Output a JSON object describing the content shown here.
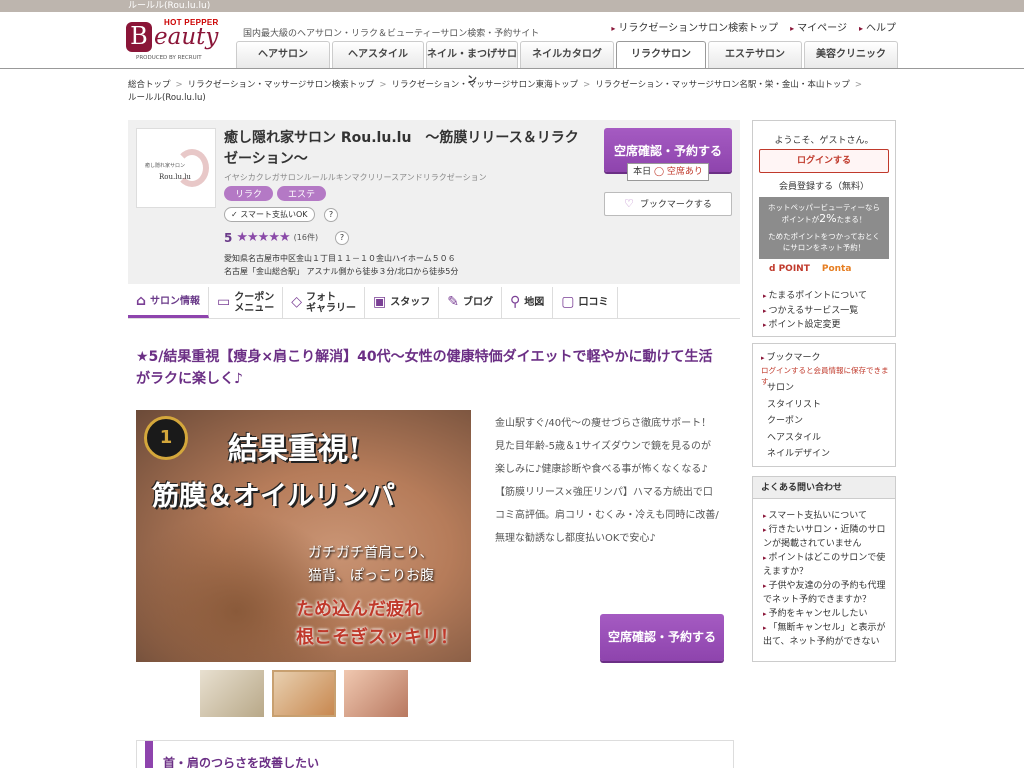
{
  "window": {
    "title": "ルールル(Rou.lu.lu)"
  },
  "header": {
    "logo": {
      "top": "HOT PEPPER",
      "b": "B",
      "rest": "eauty",
      "produced": "PRODUCED BY RECRUIT"
    },
    "tagline": "国内最大級のヘアサロン・リラク＆ビューティーサロン検索・予約サイト",
    "links": [
      "リラクゼーションサロン検索トップ",
      "マイページ",
      "ヘルプ"
    ],
    "nav": [
      "ヘアサロン",
      "ヘアスタイル",
      "ネイル・まつげサロン",
      "ネイルカタログ",
      "リラクサロン",
      "エステサロン",
      "美容クリニック"
    ]
  },
  "breadcrumb": [
    "総合トップ",
    "リラクゼーション・マッサージサロン検索トップ",
    "リラクゼーション・マッサージサロン東海トップ",
    "リラクゼーション・マッサージサロン名駅・栄・金山・本山トップ",
    "ルールル(Rou.lu.lu)"
  ],
  "salon": {
    "thumb_line1": "癒し隠れ家サロン",
    "thumb_line2": "Rou.lu.lu",
    "name": "癒し隠れ家サロン Rou.lu.lu　～筋膜リリース＆リラクゼーション～",
    "kana": "イヤシカクレガサロンルールルキンマクリリースアンドリラクゼーション",
    "tags": [
      "リラク",
      "エステ"
    ],
    "smart_pay": "✓ スマート支払いOK",
    "help_mark": "?",
    "rating": "5",
    "stars": "★★★★★",
    "review_count": "(16件)",
    "address": "愛知県名古屋市中区金山１丁目１１－１０金山ハイホーム５０６",
    "access": "名古屋「金山総合駅」 アスナル側から徒歩３分/北口から徒歩5分",
    "reserve_label": "空席確認・予約する",
    "avail_prefix": "本日",
    "avail_status": "◯ 空席あり",
    "bookmark_icon": "♡",
    "bookmark_label": "ブックマークする"
  },
  "tabs": [
    {
      "icon": "⌂",
      "label": "サロン情報"
    },
    {
      "icon": "▭",
      "label": "クーポン\nメニュー"
    },
    {
      "icon": "◇",
      "label": "フォト\nギャラリー"
    },
    {
      "icon": "▣",
      "label": "スタッフ"
    },
    {
      "icon": "✎",
      "label": "ブログ"
    },
    {
      "icon": "⚲",
      "label": "地図"
    },
    {
      "icon": "▢",
      "label": "口コミ"
    }
  ],
  "main": {
    "catch": "★5/結果重視【痩身×肩こり解消】40代～女性の健康特価ダイエットで軽やかに動けて生活がラクに楽しく♪",
    "hero": {
      "medal": "1",
      "line1": "結果重視!",
      "line2": "筋膜＆オイルリンパ",
      "line3a": "ガチガチ首肩こり、",
      "line3b": "猫背、ぽっこりお腹",
      "line4a": "ため込んだ疲れ",
      "line4b": "根こそぎスッキリ！"
    },
    "description": "金山駅すぐ/40代～の痩せづらさ徹底サポート！見た目年齢-5歳＆1サイズダウンで鏡を見るのが楽しみに♪健康診断や食べる事が怖くなくなる♪【筋膜リリース×強圧リンパ】ハマる方続出で口コミ高評価。肩コリ・むくみ・冷えも同時に改善/無理な勧誘なし都度払いOKで安心♪",
    "reserve_label": "空席確認・予約する",
    "sub_heading": "首・肩のつらさを改善したい"
  },
  "sidebar": {
    "welcome": "ようこそ、ゲストさん。",
    "login": "ログインする",
    "register": "会員登録する（無料）",
    "point_line1": "ホットペッパービューティーなら",
    "point_line2a": "ポイントが",
    "point_line2b": "2%",
    "point_line2c": "たまる！",
    "point_line3": "ためたポイントをつかっておとく",
    "point_line4": "にサロンをネット予約！",
    "dpoint": "d POINT",
    "ponta": "Ponta",
    "point_links": [
      "たまるポイントについて",
      "つかえるサービス一覧",
      "ポイント設定変更"
    ],
    "bookmark_title": "ブックマーク",
    "bookmark_note": "ログインすると会員情報に保存できます",
    "bookmark_items": [
      "サロン",
      "スタイリスト",
      "クーポン",
      "ヘアスタイル",
      "ネイルデザイン"
    ],
    "faq_title": "よくある問い合わせ",
    "faq_items": [
      "スマート支払いについて",
      "行きたいサロン・近隣のサロンが掲載されていません",
      "ポイントはどこのサロンで使えますか？",
      "子供や友達の分の予約も代理でネット予約できますか？",
      "予約をキャンセルしたい",
      "「無断キャンセル」と表示が出て、ネット予約ができない"
    ]
  }
}
